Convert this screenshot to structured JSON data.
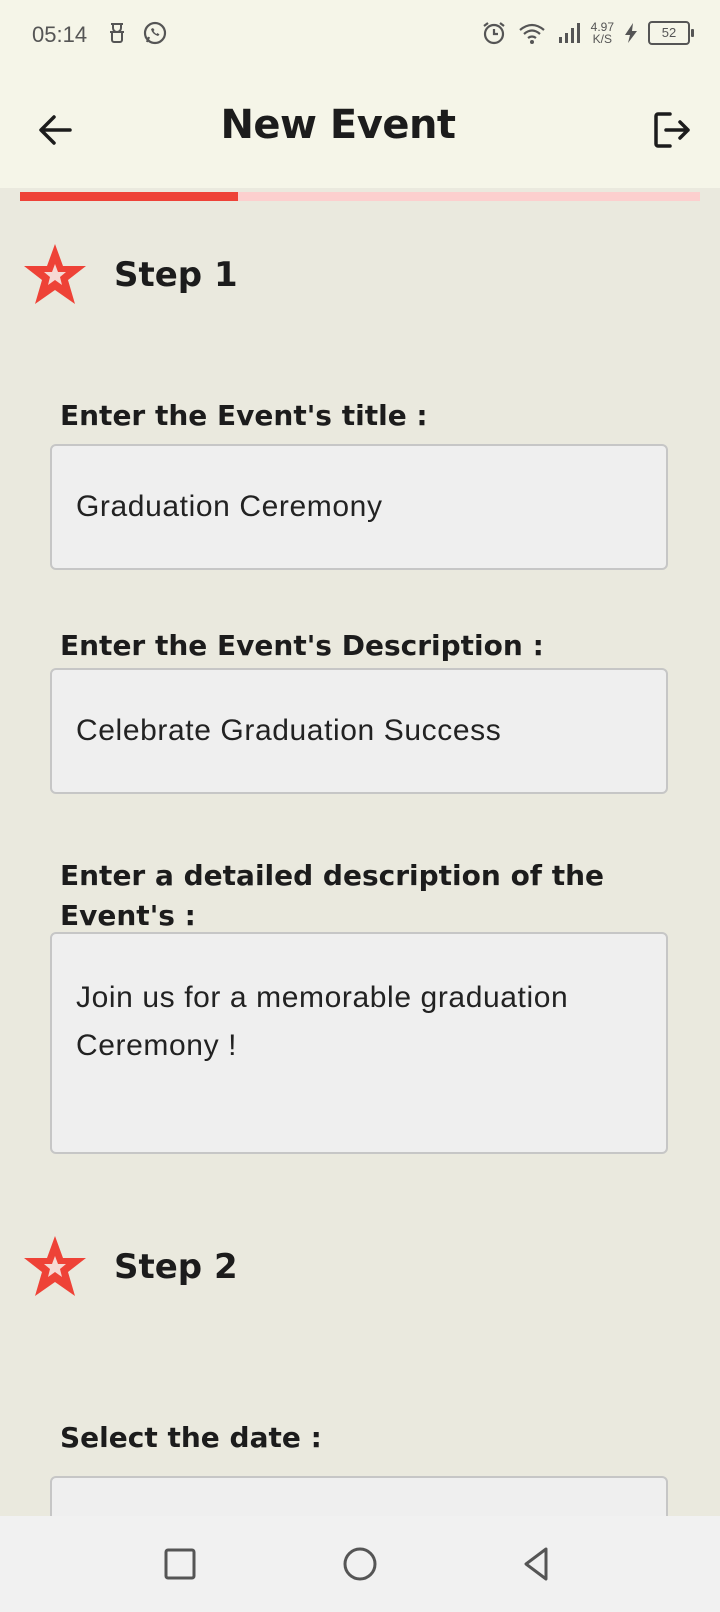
{
  "status_bar": {
    "time": "05:14",
    "net_speed_value": "4.97",
    "net_speed_unit": "K/S",
    "battery_level": "52"
  },
  "app_bar": {
    "title": "New Event",
    "back_icon": "arrow-left-icon",
    "logout_icon": "logout-icon"
  },
  "progress": {
    "fraction": 0.32,
    "fill_color": "#ee4237",
    "track_color": "#fccfce"
  },
  "step1": {
    "title": "Step 1",
    "title_label": "Enter the Event's title :",
    "title_value": "Graduation Ceremony",
    "description_label": "Enter the Event's Description :",
    "description_value": "Celebrate Graduation Success",
    "detailed_label": "Enter a detailed description of the Event's :",
    "detailed_value": "Join us for a memorable graduation Ceremony !"
  },
  "step2": {
    "title": "Step 2",
    "date_label": "Select the date :",
    "date_value": ""
  },
  "accent_color": "#ee4237"
}
